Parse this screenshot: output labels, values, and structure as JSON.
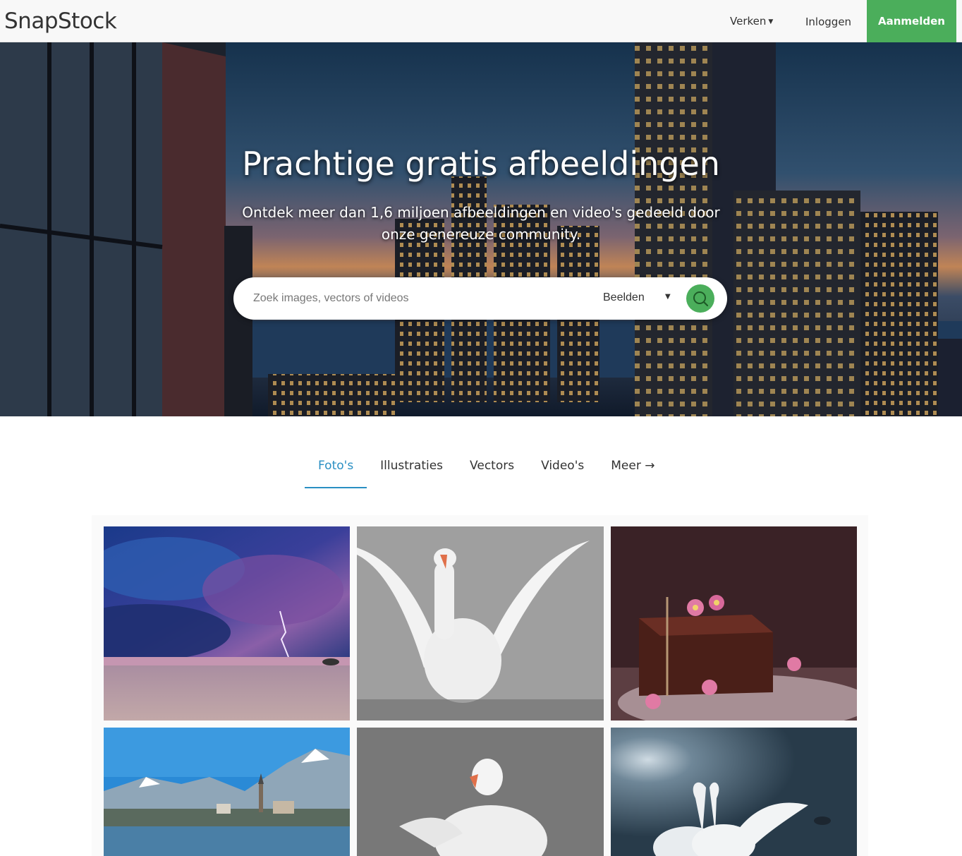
{
  "header": {
    "brand": "SnapStock",
    "explore_label": "Verken",
    "login_label": "Inloggen",
    "signup_label": "Aanmelden"
  },
  "hero": {
    "title": "Prachtige gratis afbeeldingen",
    "subtitle": "Ontdek meer dan 1,6 miljoen afbeeldingen en video's gedeeld door onze genereuze community."
  },
  "search": {
    "placeholder": "Zoek images, vectors of videos",
    "type_selected": "Beelden",
    "button_icon": "search-icon"
  },
  "tabs": [
    {
      "label": "Foto's",
      "active": true
    },
    {
      "label": "Illustraties",
      "active": false
    },
    {
      "label": "Vectors",
      "active": false
    },
    {
      "label": "Video's",
      "active": false
    },
    {
      "label": "Meer →",
      "active": false
    }
  ],
  "colors": {
    "accent_green": "#4bae5b",
    "tab_active": "#2a8fc3"
  }
}
